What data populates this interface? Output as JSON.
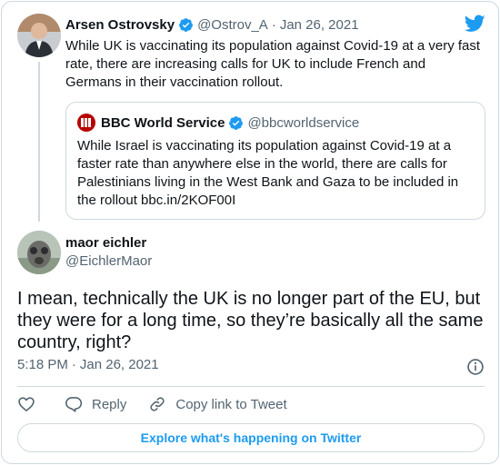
{
  "parent_tweet": {
    "author_name": "Arsen Ostrovsky",
    "handle": "@Ostrov_A",
    "separator": "·",
    "date": "Jan 26, 2021",
    "text": "While UK is vaccinating its population against Covid-19 at a very fast rate, there are increasing calls for UK to include French and Germans in their vaccination rollout."
  },
  "quoted_tweet": {
    "author_name": "BBC World Service",
    "handle": "@bbcworldservice",
    "text": "While Israel is vaccinating its population against Covid-19 at a faster rate than anywhere else in the world, there are calls for Palestinians living in the West Bank and Gaza to be included in the rollout bbc.in/2KOF00I"
  },
  "main_tweet": {
    "author_name": "maor eichler",
    "handle": "@EichlerMaor",
    "text": "I mean, technically the UK is no longer part of the EU, but they were for a long time, so they’re basically all the same country, right?",
    "time": "5:18 PM",
    "separator": "·",
    "date": "Jan 26, 2021"
  },
  "actions": {
    "reply_label": "Reply",
    "copy_link_label": "Copy link to Tweet"
  },
  "footer": {
    "explore_label": "Explore what's happening on Twitter"
  },
  "colors": {
    "accent": "#1d9bf0",
    "secondary_text": "#536471",
    "border": "#cfd9de"
  },
  "icons": [
    "verified-badge-icon",
    "twitter-bird-icon",
    "info-icon",
    "heart-icon",
    "reply-icon",
    "copy-link-icon",
    "bbc-logo-icon"
  ]
}
